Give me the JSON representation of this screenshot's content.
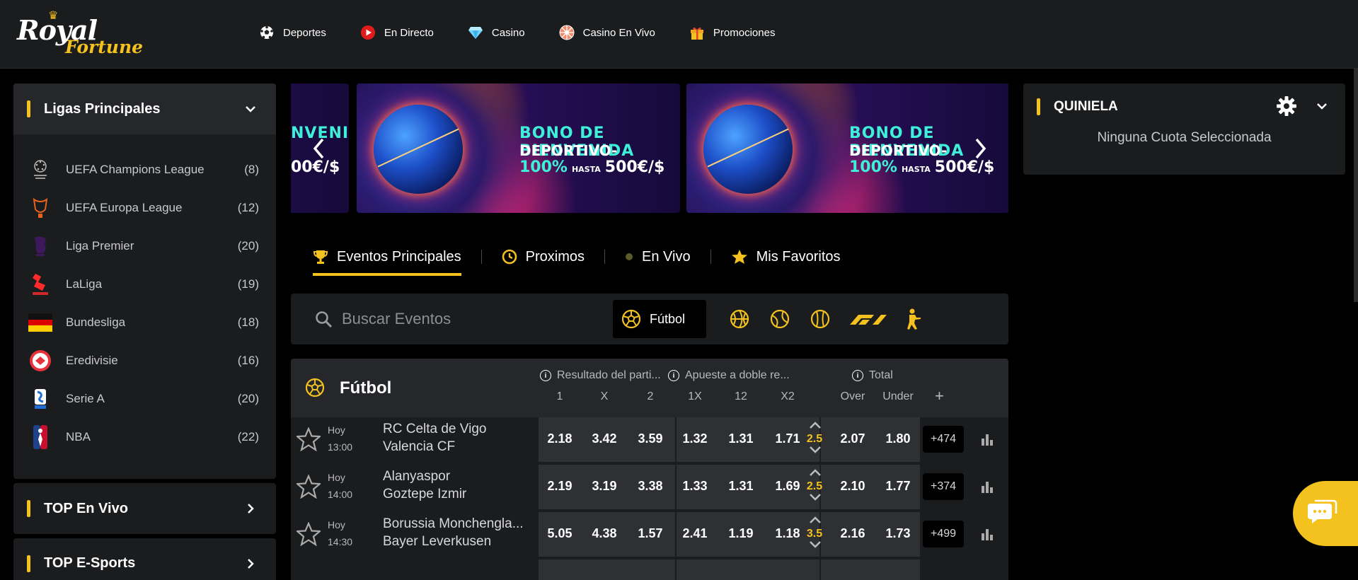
{
  "brand": {
    "line1": "Royal",
    "line2": "Fortune",
    "accent": "#f4c21f"
  },
  "nav": [
    {
      "label": "Deportes",
      "icon": "soccer-ball-icon"
    },
    {
      "label": "En Directo",
      "icon": "live-play-icon"
    },
    {
      "label": "Casino",
      "icon": "diamond-icon"
    },
    {
      "label": "Casino En Vivo",
      "icon": "roulette-icon"
    },
    {
      "label": "Promociones",
      "icon": "gift-icon"
    }
  ],
  "leagues": {
    "title": "Ligas Principales",
    "items": [
      {
        "name": "UEFA Champions League",
        "count": "(8)"
      },
      {
        "name": "UEFA Europa League",
        "count": "(12)"
      },
      {
        "name": "Liga Premier",
        "count": "(20)"
      },
      {
        "name": "LaLiga",
        "count": "(19)"
      },
      {
        "name": "Bundesliga",
        "count": "(18)"
      },
      {
        "name": "Eredivisie",
        "count": "(16)"
      },
      {
        "name": "Serie A",
        "count": "(20)"
      },
      {
        "name": "NBA",
        "count": "(22)"
      }
    ]
  },
  "top_live": {
    "title": "TOP En Vivo"
  },
  "top_esports": {
    "title": "TOP E-Sports"
  },
  "banner": {
    "line1": "BONO DE BIENVENIDA",
    "line2": "DEPORTIVO-",
    "line3_pct": "100%",
    "line3_hasta": "HASTA",
    "line3_amount": "500€/$",
    "partial_left_line1": "NVENIDA",
    "partial_left_line2": "00€/$"
  },
  "tabs": [
    {
      "label": "Eventos Principales",
      "icon": "trophy-icon"
    },
    {
      "label": "Proximos",
      "icon": "clock-icon"
    },
    {
      "label": "En Vivo",
      "icon": "live-dot-icon"
    },
    {
      "label": "Mis Favoritos",
      "icon": "star-icon"
    }
  ],
  "search": {
    "placeholder": "Buscar Eventos",
    "active_sport": "Fútbol"
  },
  "events": {
    "sport": "Fútbol",
    "markets": {
      "m1": "Resultado del parti...",
      "m2": "Apueste a doble re...",
      "m3": "Total"
    },
    "columns": [
      "1",
      "X",
      "2",
      "1X",
      "12",
      "X2",
      "Over",
      "Under"
    ],
    "plus": "+",
    "rows": [
      {
        "day": "Hoy",
        "time": "13:00",
        "home": "RC Celta de Vigo",
        "away": "Valencia CF",
        "odds": [
          "2.18",
          "3.42",
          "3.59",
          "1.32",
          "1.31",
          "1.71"
        ],
        "line": "2.5",
        "over": "2.07",
        "under": "1.80",
        "more": "+474"
      },
      {
        "day": "Hoy",
        "time": "14:00",
        "home": "Alanyaspor",
        "away": "Goztepe Izmir",
        "odds": [
          "2.19",
          "3.19",
          "3.38",
          "1.33",
          "1.31",
          "1.69"
        ],
        "line": "2.5",
        "over": "2.10",
        "under": "1.77",
        "more": "+374"
      },
      {
        "day": "Hoy",
        "time": "14:30",
        "home": "Borussia Monchengla...",
        "away": "Bayer Leverkusen",
        "odds": [
          "5.05",
          "4.38",
          "1.57",
          "2.41",
          "1.19",
          "1.18"
        ],
        "line": "3.5",
        "over": "2.16",
        "under": "1.73",
        "more": "+499"
      }
    ]
  },
  "quiniela": {
    "title": "QUINIELA",
    "empty": "Ninguna Cuota Seleccionada"
  }
}
